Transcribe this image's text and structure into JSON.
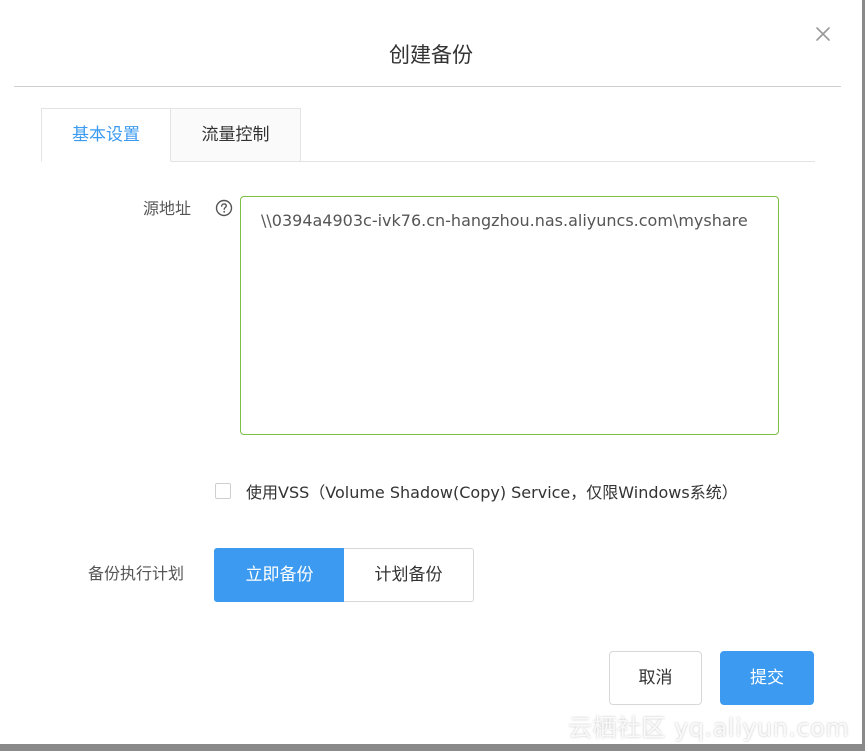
{
  "dialog": {
    "title": "创建备份"
  },
  "tabs": [
    {
      "label": "基本设置",
      "active": true
    },
    {
      "label": "流量控制",
      "active": false
    }
  ],
  "source": {
    "label": "源地址",
    "value": "\\\\0394a4903c-ivk76.cn-hangzhou.nas.aliyuncs.com\\myshare"
  },
  "vss": {
    "checked": false,
    "label": "使用VSS（Volume Shadow(Copy) Service，仅限Windows系统）"
  },
  "schedule": {
    "label": "备份执行计划",
    "options": [
      "立即备份",
      "计划备份"
    ],
    "selected": "立即备份"
  },
  "footer": {
    "cancel_label": "取消",
    "submit_label": "提交"
  },
  "watermark": "云栖社区 yq.aliyun.com",
  "colors": {
    "primary": "#3c9bf0",
    "focus_border": "#7cc043",
    "text": "#333333"
  }
}
